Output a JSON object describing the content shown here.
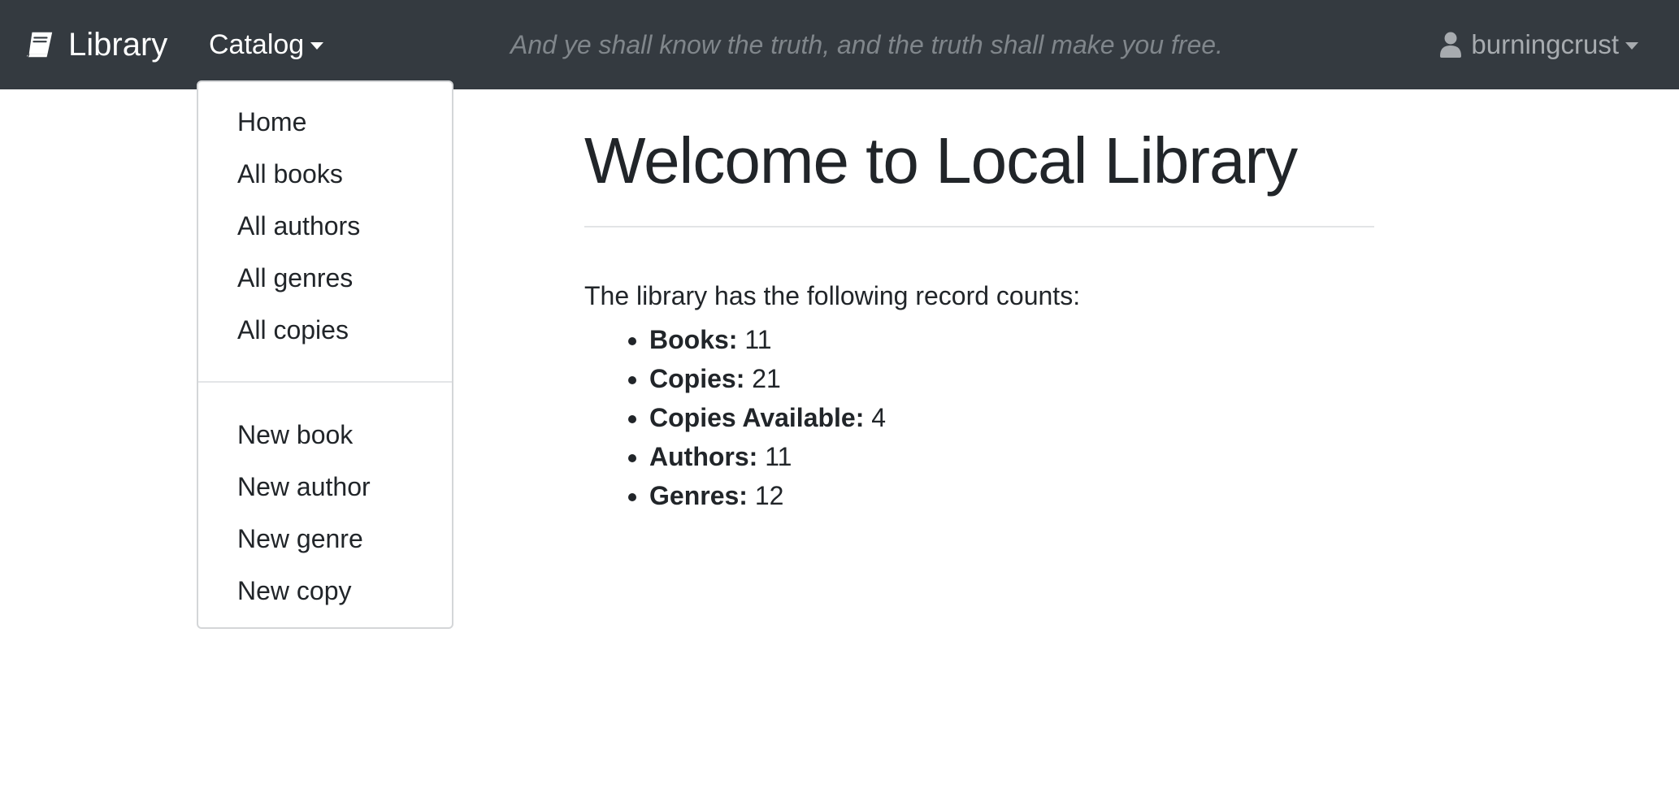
{
  "navbar": {
    "brand_label": "Library",
    "brand_icon": "book-icon",
    "catalog_label": "Catalog",
    "motto": "And ye shall know the truth, and the truth shall make you free.",
    "user_icon": "user-icon",
    "username": "burningcrust",
    "background_color": "#343a40"
  },
  "catalog_menu": {
    "browse_items": [
      {
        "label": "Home"
      },
      {
        "label": "All books"
      },
      {
        "label": "All authors"
      },
      {
        "label": "All genres"
      },
      {
        "label": "All copies"
      }
    ],
    "create_items": [
      {
        "label": "New book"
      },
      {
        "label": "New author"
      },
      {
        "label": "New genre"
      },
      {
        "label": "New copy"
      }
    ]
  },
  "main": {
    "title": "Welcome to Local Library",
    "intro": "The library has the following record counts:",
    "counts": [
      {
        "label": "Books:",
        "value": "11"
      },
      {
        "label": "Copies:",
        "value": "21"
      },
      {
        "label": "Copies Available:",
        "value": "4"
      },
      {
        "label": "Authors:",
        "value": "11"
      },
      {
        "label": "Genres:",
        "value": "12"
      }
    ]
  }
}
